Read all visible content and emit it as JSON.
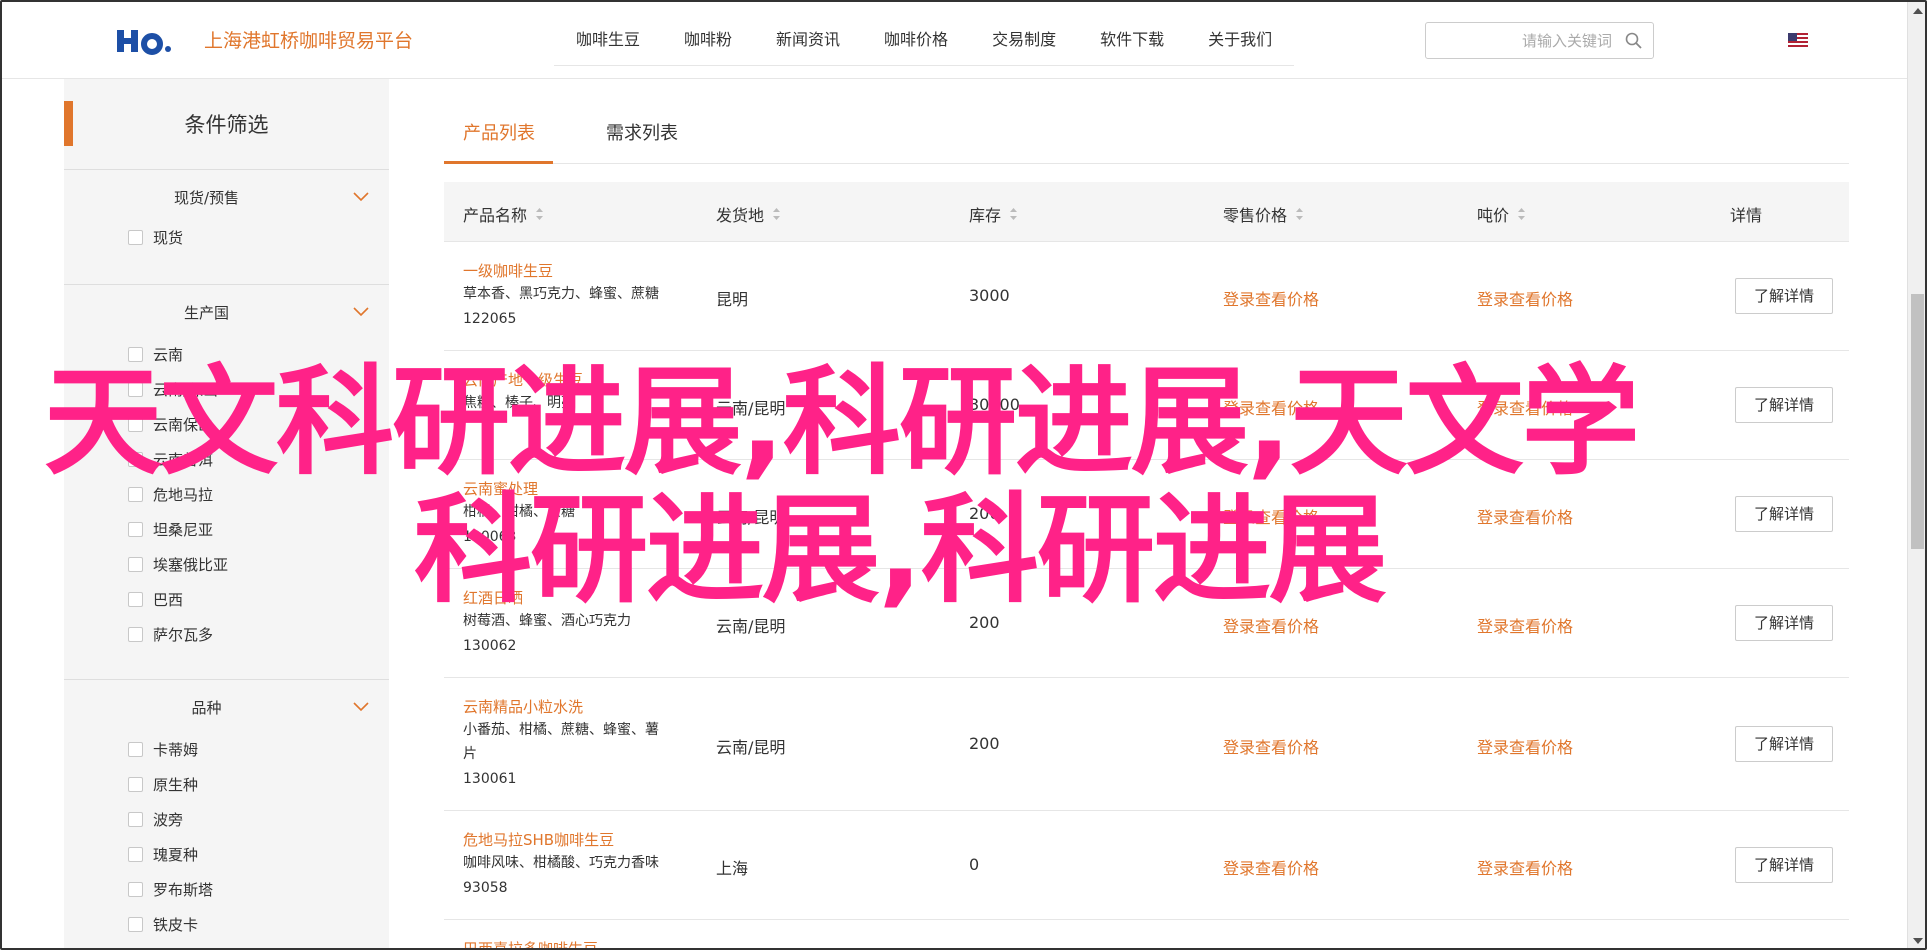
{
  "header": {
    "brand_name": "上海港虹桥咖啡贸易平台",
    "nav": [
      "咖啡生豆",
      "咖啡粉",
      "新闻资讯",
      "咖啡价格",
      "交易制度",
      "软件下载",
      "关于我们"
    ],
    "search_placeholder": "请输入关键词"
  },
  "sidebar": {
    "title": "条件筛选",
    "groups": [
      {
        "title": "现货/预售",
        "options": [
          "现货"
        ]
      },
      {
        "title": "生产国",
        "options": [
          "云南",
          "云南/保山",
          "云南保山",
          "云南普洱",
          "危地马拉",
          "坦桑尼亚",
          "埃塞俄比亚",
          "巴西",
          "萨尔瓦多"
        ]
      },
      {
        "title": "品种",
        "options": [
          "卡蒂姆",
          "原生种",
          "波旁",
          "瑰夏种",
          "罗布斯塔",
          "铁皮卡"
        ]
      }
    ]
  },
  "tabs": [
    "产品列表",
    "需求列表"
  ],
  "table": {
    "columns": [
      "产品名称",
      "发货地",
      "库存",
      "零售价格",
      "吨价",
      "详情"
    ],
    "price_text": "登录查看价格",
    "detail_label": "了解详情",
    "rows": [
      {
        "name": "一级咖啡生豆",
        "desc": [
          "草本香、黑巧克力、蜂蜜、蔗糖"
        ],
        "code": "122065",
        "origin": "昆明",
        "stock": "3000"
      },
      {
        "name": "云南产地一级生豆",
        "desc": [
          "焦糖、榛子、明亮"
        ],
        "code": "",
        "origin": "云南/昆明",
        "stock": "30000"
      },
      {
        "name": "云南蜜处理",
        "desc": [
          "柑橘、柑橘、蔗糖"
        ],
        "code": "130063",
        "origin": "云南/昆明",
        "stock": "200"
      },
      {
        "name": "红酒日晒",
        "desc": [
          "树莓酒、蜂蜜、酒心巧克力"
        ],
        "code": "130062",
        "origin": "云南/昆明",
        "stock": "200"
      },
      {
        "name": "云南精品小粒水洗",
        "desc": [
          "小番茄、柑橘、蔗糖、蜂蜜、薯",
          "片"
        ],
        "code": "130061",
        "origin": "云南/昆明",
        "stock": "200"
      },
      {
        "name": "危地马拉SHB咖啡生豆",
        "desc": [
          "咖啡风味、柑橘酸、巧克力香味"
        ],
        "code": "93058",
        "origin": "上海",
        "stock": "0"
      },
      {
        "name": "巴西喜拉多咖啡生豆",
        "desc": [],
        "code": "",
        "origin": "",
        "stock": ""
      }
    ]
  },
  "watermark": {
    "line1": "天文科研进展,科研进展,天文学",
    "line2": "科研进展,科研进展"
  },
  "colors": {
    "accent": "#e0762c",
    "watermark": "#ff2288"
  }
}
